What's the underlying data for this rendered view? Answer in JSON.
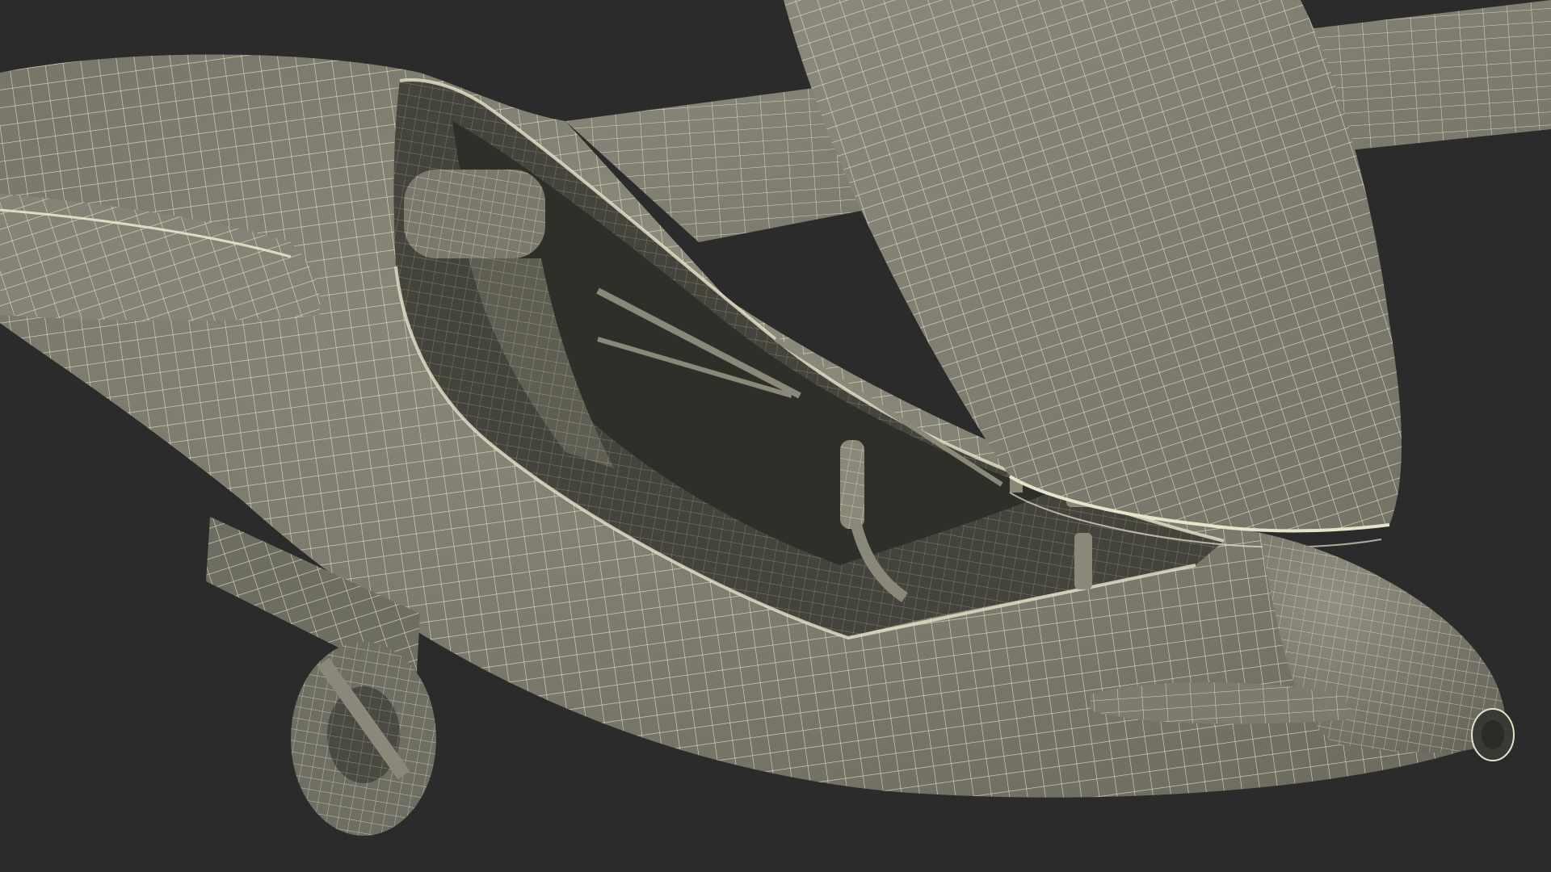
{
  "scene": {
    "subject": "glider-wireframe-render",
    "colors": {
      "background": "#2b2b2b",
      "surface": "#7f7e70",
      "surface_dark": "#5f5e52",
      "surface_light": "#908f80",
      "interior": "#45443c",
      "interior_deep": "#2f2f2a",
      "wire": "#e8e4cc"
    }
  }
}
